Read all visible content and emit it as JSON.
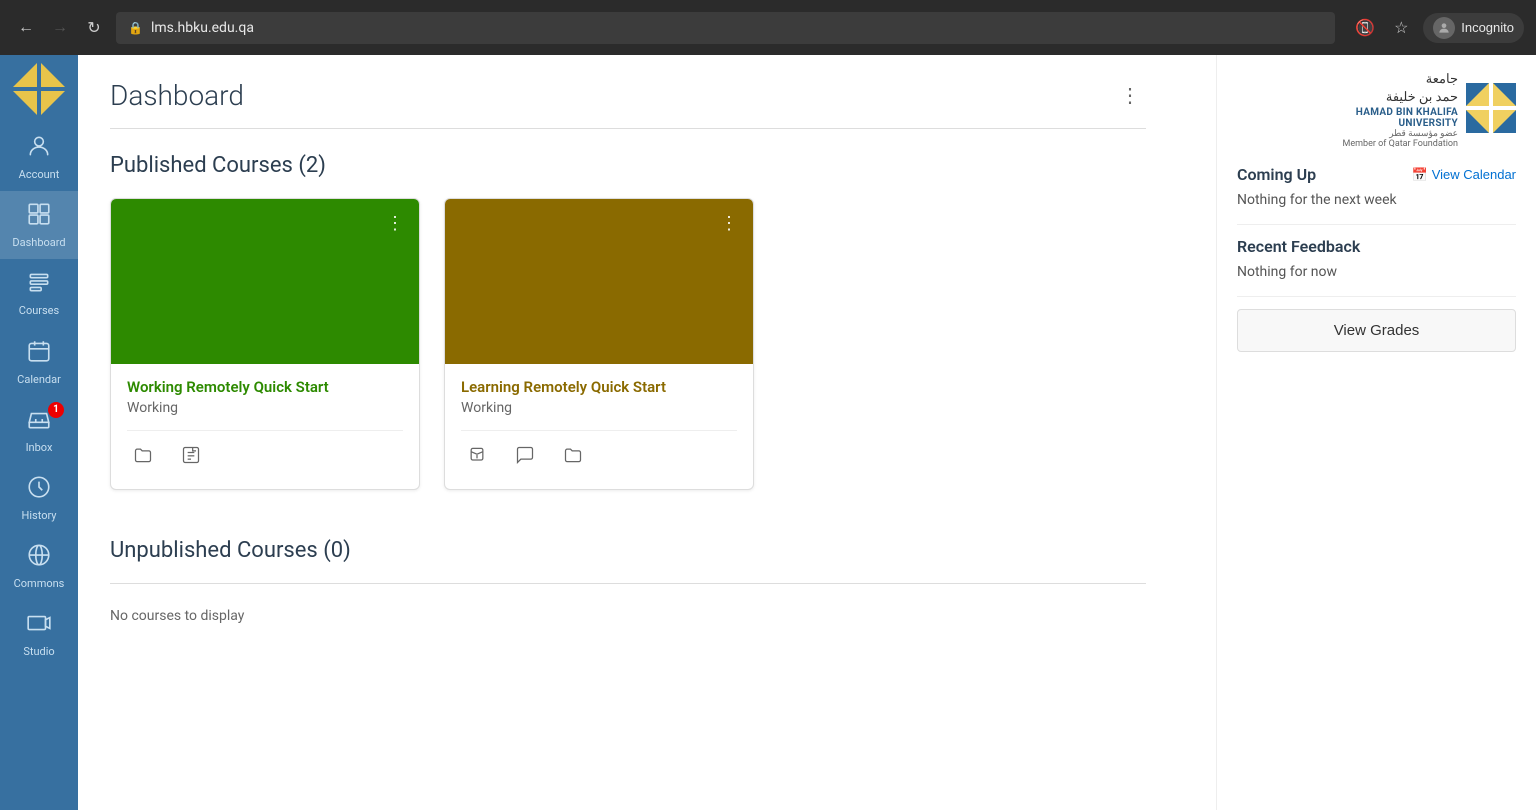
{
  "browser": {
    "url": "lms.hbku.edu.qa",
    "profile": "Incognito"
  },
  "sidebar": {
    "items": [
      {
        "id": "account",
        "label": "Account",
        "icon": "👤"
      },
      {
        "id": "dashboard",
        "label": "Dashboard",
        "icon": "📊",
        "active": true
      },
      {
        "id": "courses",
        "label": "Courses",
        "icon": "📋"
      },
      {
        "id": "calendar",
        "label": "Calendar",
        "icon": "📅"
      },
      {
        "id": "inbox",
        "label": "Inbox",
        "icon": "💬",
        "badge": "1"
      },
      {
        "id": "history",
        "label": "History",
        "icon": "🕐"
      },
      {
        "id": "commons",
        "label": "Commons",
        "icon": "🔄"
      },
      {
        "id": "studio",
        "label": "Studio",
        "icon": "🎬"
      }
    ]
  },
  "page": {
    "title": "Dashboard",
    "menu_label": "⋮"
  },
  "published_courses": {
    "section_title": "Published Courses (2)",
    "courses": [
      {
        "id": "working-remotely",
        "title": "Working Remotely Quick Start",
        "status": "Working",
        "color": "green",
        "actions": [
          "folder",
          "edit"
        ]
      },
      {
        "id": "learning-remotely",
        "title": "Learning Remotely Quick Start",
        "status": "Working",
        "color": "brown",
        "actions": [
          "announce",
          "chat",
          "folder"
        ]
      }
    ]
  },
  "unpublished_courses": {
    "section_title": "Unpublished Courses (0)",
    "no_courses_text": "No courses to display"
  },
  "right_panel": {
    "university": {
      "name_ar": "جامعة\nحمد بن خليفة",
      "name_en": "HAMAD BIN KHALIFA\nUNIVERSITY",
      "subtitle": "عضو مؤسسة قطر\nMember of Qatar Foundation"
    },
    "coming_up": {
      "title": "Coming Up",
      "view_calendar_label": "View Calendar",
      "nothing_next_week": "Nothing for the next week"
    },
    "recent_feedback": {
      "title": "Recent Feedback",
      "nothing_now": "Nothing for now"
    },
    "view_grades_label": "View Grades"
  }
}
